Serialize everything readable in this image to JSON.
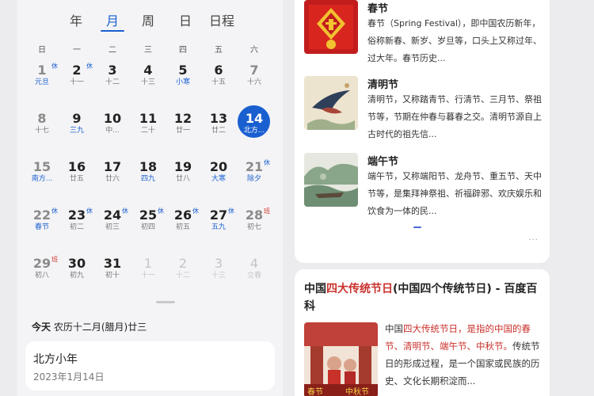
{
  "calendar": {
    "tabs": [
      {
        "label": "年",
        "active": false
      },
      {
        "label": "月",
        "active": true
      },
      {
        "label": "周",
        "active": false
      },
      {
        "label": "日",
        "active": false
      },
      {
        "label": "日程",
        "active": false
      }
    ],
    "weekdays": [
      "日",
      "一",
      "二",
      "三",
      "四",
      "五",
      "六"
    ],
    "days": [
      [
        {
          "num": "1",
          "lunar": "元旦",
          "tag": "休",
          "blue": true
        },
        {
          "num": "2",
          "lunar": "十一",
          "tag": "休"
        },
        {
          "num": "3",
          "lunar": "十二"
        },
        {
          "num": "4",
          "lunar": "十三"
        },
        {
          "num": "5",
          "lunar": "小寒",
          "blue": true
        },
        {
          "num": "6",
          "lunar": "十五"
        },
        {
          "num": "7",
          "lunar": "十六"
        }
      ],
      [
        {
          "num": "8",
          "lunar": "十七"
        },
        {
          "num": "9",
          "lunar": "三九",
          "blue": true
        },
        {
          "num": "10",
          "lunar": "中..."
        },
        {
          "num": "11",
          "lunar": "二十"
        },
        {
          "num": "12",
          "lunar": "廿一"
        },
        {
          "num": "13",
          "lunar": "廿二"
        },
        {
          "num": "14",
          "lunar": "北方...",
          "today": true
        }
      ],
      [
        {
          "num": "15",
          "lunar": "南方...",
          "blue": true
        },
        {
          "num": "16",
          "lunar": "廿五"
        },
        {
          "num": "17",
          "lunar": "廿六"
        },
        {
          "num": "18",
          "lunar": "四九",
          "blue": true
        },
        {
          "num": "19",
          "lunar": "廿八"
        },
        {
          "num": "20",
          "lunar": "大寒",
          "blue": true
        },
        {
          "num": "21",
          "lunar": "除夕",
          "tag": "休",
          "blue": true
        }
      ],
      [
        {
          "num": "22",
          "lunar": "春节",
          "tag": "休",
          "blue": true
        },
        {
          "num": "23",
          "lunar": "初二",
          "tag": "休"
        },
        {
          "num": "24",
          "lunar": "初三",
          "tag": "休"
        },
        {
          "num": "25",
          "lunar": "初四",
          "tag": "休"
        },
        {
          "num": "26",
          "lunar": "初五",
          "tag": "休"
        },
        {
          "num": "27",
          "lunar": "五九",
          "tag": "休",
          "blue": true
        },
        {
          "num": "28",
          "lunar": "初七",
          "tag": "班",
          "red": true
        }
      ],
      [
        {
          "num": "29",
          "lunar": "初八",
          "tag": "班",
          "red": true
        },
        {
          "num": "30",
          "lunar": "初九"
        },
        {
          "num": "31",
          "lunar": "初十"
        },
        {
          "num": "1",
          "lunar": "十一",
          "dim": true
        },
        {
          "num": "2",
          "lunar": "十二",
          "dim": true
        },
        {
          "num": "3",
          "lunar": "十三",
          "dim": true
        },
        {
          "num": "4",
          "lunar": "立春",
          "dim": true
        }
      ]
    ],
    "today_prefix": "今天",
    "today_lunar": "农历十二月(腊月)廿三",
    "event_title": "北方小年",
    "event_date": "2023年1月14日"
  },
  "results": {
    "festivals": [
      {
        "title": "春节",
        "desc": "春节（Spring Festival），即中国农历新年，俗称新春、新岁、岁旦等，口头上又称过年、过大年。春节历史..."
      },
      {
        "title": "清明节",
        "desc": "清明节，又称踏青节、行清节、三月节、祭祖节等，节期在仲春与暮春之交。清明节源自上古时代的祖先信..."
      },
      {
        "title": "端午节",
        "desc": "端午节，又称端阳节、龙舟节、重五节、天中节等，是集拜神祭祖、祈福辟邪、欢庆娱乐和饮食为一体的民..."
      }
    ],
    "more": "···",
    "baike_title_pre": "中国",
    "baike_title_hl": "四大传统节日",
    "baike_title_post": "(中国四个传统节日) - 百度百科",
    "baike_img_left": "春节",
    "baike_img_right": "中秋节",
    "baike_desc_pre": "中国",
    "baike_desc_hl": "四大传统节日，是指的中国的春节、清明节、端午节、中秋节。",
    "baike_desc_post": "传统节日的形成过程，是一个国家或民族的历史、文化长期积淀而..."
  },
  "colors": {
    "accent": "#1a5fd0",
    "highlight": "#c9302c",
    "rest_tag": "#1a5fd0",
    "work_tag": "#d0382b"
  }
}
